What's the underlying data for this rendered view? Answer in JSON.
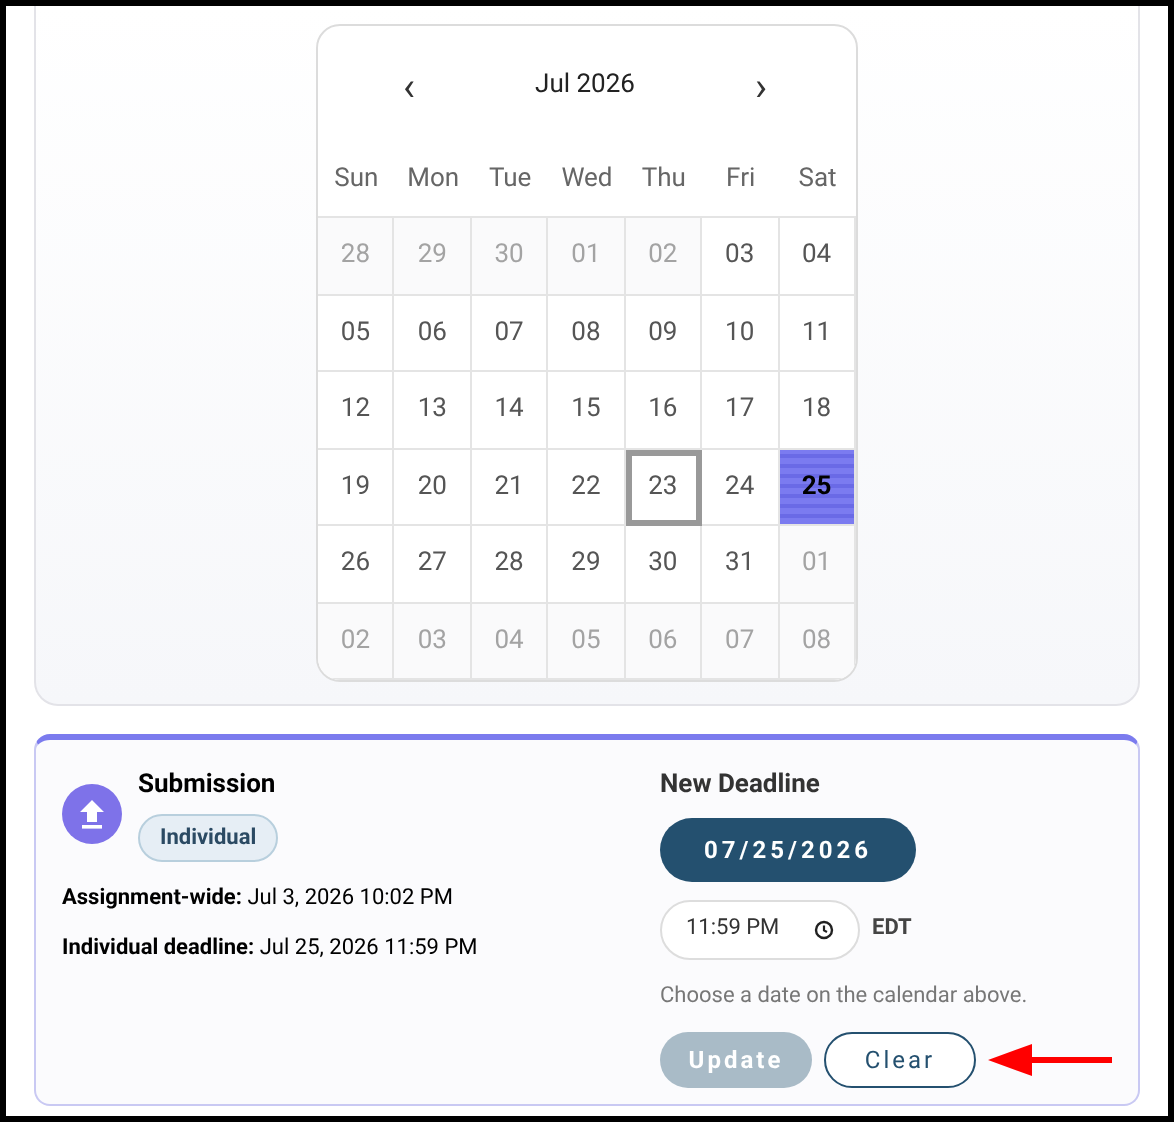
{
  "calendar": {
    "month_label": "Jul 2026",
    "prev": "‹",
    "next": "›",
    "weekdays": [
      "Sun",
      "Mon",
      "Tue",
      "Wed",
      "Thu",
      "Fri",
      "Sat"
    ],
    "weeks": [
      [
        {
          "day": "28",
          "outside": true,
          "today": false,
          "selected": false
        },
        {
          "day": "29",
          "outside": true,
          "today": false,
          "selected": false
        },
        {
          "day": "30",
          "outside": true,
          "today": false,
          "selected": false
        },
        {
          "day": "01",
          "outside": true,
          "today": false,
          "selected": false
        },
        {
          "day": "02",
          "outside": true,
          "today": false,
          "selected": false
        },
        {
          "day": "03",
          "outside": false,
          "today": false,
          "selected": false
        },
        {
          "day": "04",
          "outside": false,
          "today": false,
          "selected": false
        }
      ],
      [
        {
          "day": "05",
          "outside": false,
          "today": false,
          "selected": false
        },
        {
          "day": "06",
          "outside": false,
          "today": false,
          "selected": false
        },
        {
          "day": "07",
          "outside": false,
          "today": false,
          "selected": false
        },
        {
          "day": "08",
          "outside": false,
          "today": false,
          "selected": false
        },
        {
          "day": "09",
          "outside": false,
          "today": false,
          "selected": false
        },
        {
          "day": "10",
          "outside": false,
          "today": false,
          "selected": false
        },
        {
          "day": "11",
          "outside": false,
          "today": false,
          "selected": false
        }
      ],
      [
        {
          "day": "12",
          "outside": false,
          "today": false,
          "selected": false
        },
        {
          "day": "13",
          "outside": false,
          "today": false,
          "selected": false
        },
        {
          "day": "14",
          "outside": false,
          "today": false,
          "selected": false
        },
        {
          "day": "15",
          "outside": false,
          "today": false,
          "selected": false
        },
        {
          "day": "16",
          "outside": false,
          "today": false,
          "selected": false
        },
        {
          "day": "17",
          "outside": false,
          "today": false,
          "selected": false
        },
        {
          "day": "18",
          "outside": false,
          "today": false,
          "selected": false
        }
      ],
      [
        {
          "day": "19",
          "outside": false,
          "today": false,
          "selected": false
        },
        {
          "day": "20",
          "outside": false,
          "today": false,
          "selected": false
        },
        {
          "day": "21",
          "outside": false,
          "today": false,
          "selected": false
        },
        {
          "day": "22",
          "outside": false,
          "today": false,
          "selected": false
        },
        {
          "day": "23",
          "outside": false,
          "today": true,
          "selected": false
        },
        {
          "day": "24",
          "outside": false,
          "today": false,
          "selected": false
        },
        {
          "day": "25",
          "outside": false,
          "today": false,
          "selected": true
        }
      ],
      [
        {
          "day": "26",
          "outside": false,
          "today": false,
          "selected": false
        },
        {
          "day": "27",
          "outside": false,
          "today": false,
          "selected": false
        },
        {
          "day": "28",
          "outside": false,
          "today": false,
          "selected": false
        },
        {
          "day": "29",
          "outside": false,
          "today": false,
          "selected": false
        },
        {
          "day": "30",
          "outside": false,
          "today": false,
          "selected": false
        },
        {
          "day": "31",
          "outside": false,
          "today": false,
          "selected": false
        },
        {
          "day": "01",
          "outside": true,
          "today": false,
          "selected": false
        }
      ],
      [
        {
          "day": "02",
          "outside": true,
          "today": false,
          "selected": false
        },
        {
          "day": "03",
          "outside": true,
          "today": false,
          "selected": false
        },
        {
          "day": "04",
          "outside": true,
          "today": false,
          "selected": false
        },
        {
          "day": "05",
          "outside": true,
          "today": false,
          "selected": false
        },
        {
          "day": "06",
          "outside": true,
          "today": false,
          "selected": false
        },
        {
          "day": "07",
          "outside": true,
          "today": false,
          "selected": false
        },
        {
          "day": "08",
          "outside": true,
          "today": false,
          "selected": false
        }
      ]
    ]
  },
  "submission": {
    "title": "Submission",
    "badge": "Individual",
    "details": [
      {
        "label": "Assignment-wide:",
        "value": "Jul 3, 2026 10:02 PM"
      },
      {
        "label": "Individual deadline:",
        "value": "Jul 25, 2026 11:59 PM"
      }
    ]
  },
  "new_deadline": {
    "title": "New Deadline",
    "date": "07/25/2026",
    "time": "11:59 PM",
    "timezone": "EDT",
    "hint": "Choose a date on the calendar above.",
    "buttons": [
      {
        "label": "Update",
        "disabled": true
      },
      {
        "label": "Clear",
        "disabled": false
      }
    ]
  }
}
